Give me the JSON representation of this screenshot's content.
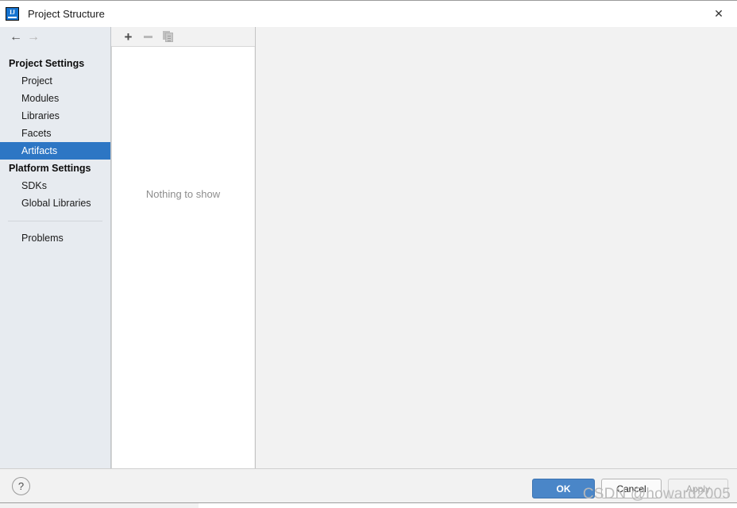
{
  "window": {
    "title": "Project Structure",
    "app_icon": "intellij-idea-icon",
    "icon_letters": "IJ",
    "close_label": "✕"
  },
  "nav": {
    "back_icon": "←",
    "forward_icon": "→"
  },
  "sidebar": {
    "groups": [
      {
        "title": "Project Settings",
        "items": [
          {
            "label": "Project",
            "selected": false
          },
          {
            "label": "Modules",
            "selected": false
          },
          {
            "label": "Libraries",
            "selected": false
          },
          {
            "label": "Facets",
            "selected": false
          },
          {
            "label": "Artifacts",
            "selected": true
          }
        ]
      },
      {
        "title": "Platform Settings",
        "items": [
          {
            "label": "SDKs",
            "selected": false
          },
          {
            "label": "Global Libraries",
            "selected": false
          }
        ]
      }
    ],
    "extra_items": [
      {
        "label": "Problems",
        "selected": false
      }
    ]
  },
  "toolbar": {
    "add_label": "+",
    "add_icon": "plus-icon",
    "remove_icon": "minus-icon",
    "copy_icon": "copy-icon"
  },
  "list_panel": {
    "empty_message": "Nothing to show"
  },
  "footer": {
    "help_label": "?",
    "ok_label": "OK",
    "cancel_label": "Cancel",
    "apply_label": "Apply"
  },
  "watermark": {
    "text": "CSDN @howard2005"
  },
  "colors": {
    "accent": "#2d76c4",
    "primary_button": "#4a86c8",
    "sidebar_bg": "#e7ebf0",
    "dialog_bg": "#f2f2f2",
    "panel_bg": "#ffffff",
    "empty_text": "#8d8d8d",
    "watermark": "#b9b9b9"
  }
}
